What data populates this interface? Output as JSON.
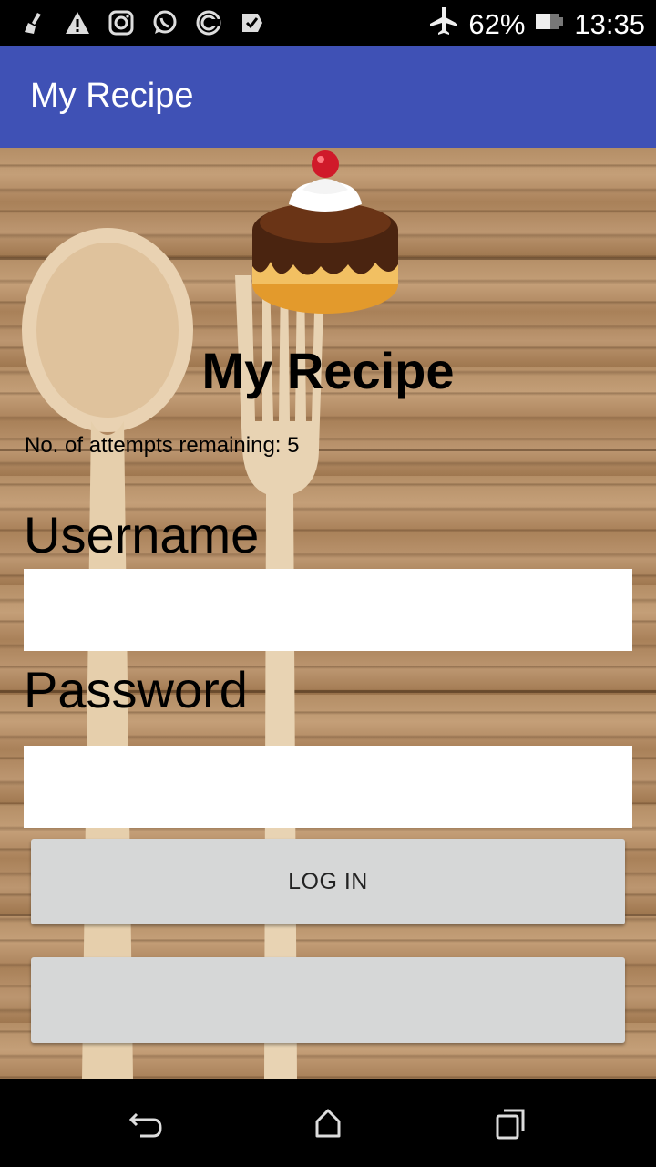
{
  "status_bar": {
    "battery_percent": "62%",
    "time": "13:35",
    "notification_icons": [
      "broom-icon",
      "warning-icon",
      "instagram-icon",
      "whatsapp-icon",
      "sync-icon",
      "check-box-icon"
    ],
    "system_icons": [
      "airplane-icon",
      "battery-icon"
    ]
  },
  "app_bar": {
    "title": "My Recipe",
    "color": "#3F51B5"
  },
  "main": {
    "headline": "My Recipe",
    "attempts_text": "No. of attempts remaining: 5",
    "username_label": "Username",
    "username_value": "",
    "password_label": "Password",
    "password_value": "",
    "login_button": "LOG IN",
    "second_button": ""
  },
  "nav_bar": {
    "icons": [
      "back-icon",
      "home-icon",
      "recents-icon"
    ]
  }
}
